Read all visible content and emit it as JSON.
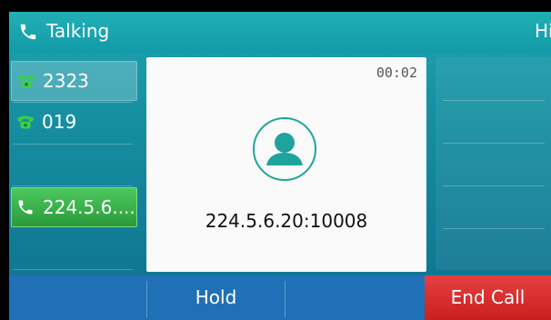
{
  "status": {
    "title": "Talking",
    "right_text": "Hi"
  },
  "lines": [
    {
      "label": "2323",
      "state": "selected",
      "icon": "phone-green-icon"
    },
    {
      "label": "019",
      "state": "idle",
      "icon": "phone-green-icon"
    },
    {
      "label": "224.5.6....",
      "state": "active-call",
      "icon": "handset-white-icon"
    }
  ],
  "call": {
    "timer": "00:02",
    "callee": "224.5.6.20:10008",
    "avatar_icon": "contact-avatar-icon"
  },
  "softkeys": [
    {
      "label": ""
    },
    {
      "label": "Hold"
    },
    {
      "label": ""
    },
    {
      "label": "End Call"
    }
  ],
  "colors": {
    "accent_teal": "#18a0ab",
    "softkey_blue": "#1f70b6",
    "end_call_red": "#d42a2a",
    "active_green": "#3cb84e"
  }
}
